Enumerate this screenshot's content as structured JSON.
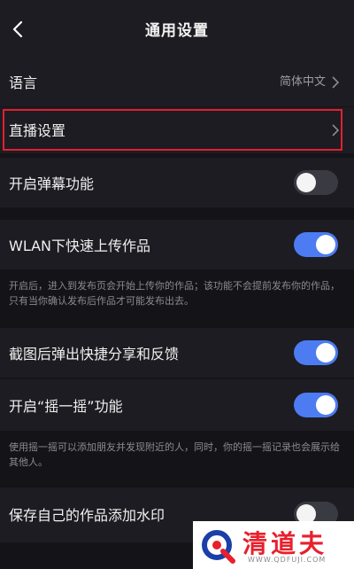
{
  "header": {
    "title": "通用设置"
  },
  "rows": {
    "language": {
      "label": "语言",
      "value": "简体中文"
    },
    "live": {
      "label": "直播设置"
    },
    "danmu": {
      "label": "开启弹幕功能",
      "on": false
    },
    "wlan": {
      "label": "WLAN下快速上传作品",
      "on": true
    },
    "screenshot": {
      "label": "截图后弹出快捷分享和反馈",
      "on": true
    },
    "shake": {
      "label": "开启“摇一摇”功能",
      "on": true
    },
    "watermark_save": {
      "label": "保存自己的作品添加水印",
      "on": false
    }
  },
  "notes": {
    "wlan": "开启后，进入到发布页会开始上传你的作品；该功能不会提前发布你的作品，只有当你确认发布后作品才可能发布出去。",
    "shake": "使用摇一摇可以添加朋友并发现附近的人，同时，你的摇一摇记录也会展示给其他人。"
  },
  "site_watermark": {
    "name": "清道夫",
    "url": "WWW.QDFUJI.COM"
  },
  "colors": {
    "accent": "#4d7cf2",
    "highlight": "#e02030",
    "background": "#141418",
    "row": "#1c1c22"
  }
}
